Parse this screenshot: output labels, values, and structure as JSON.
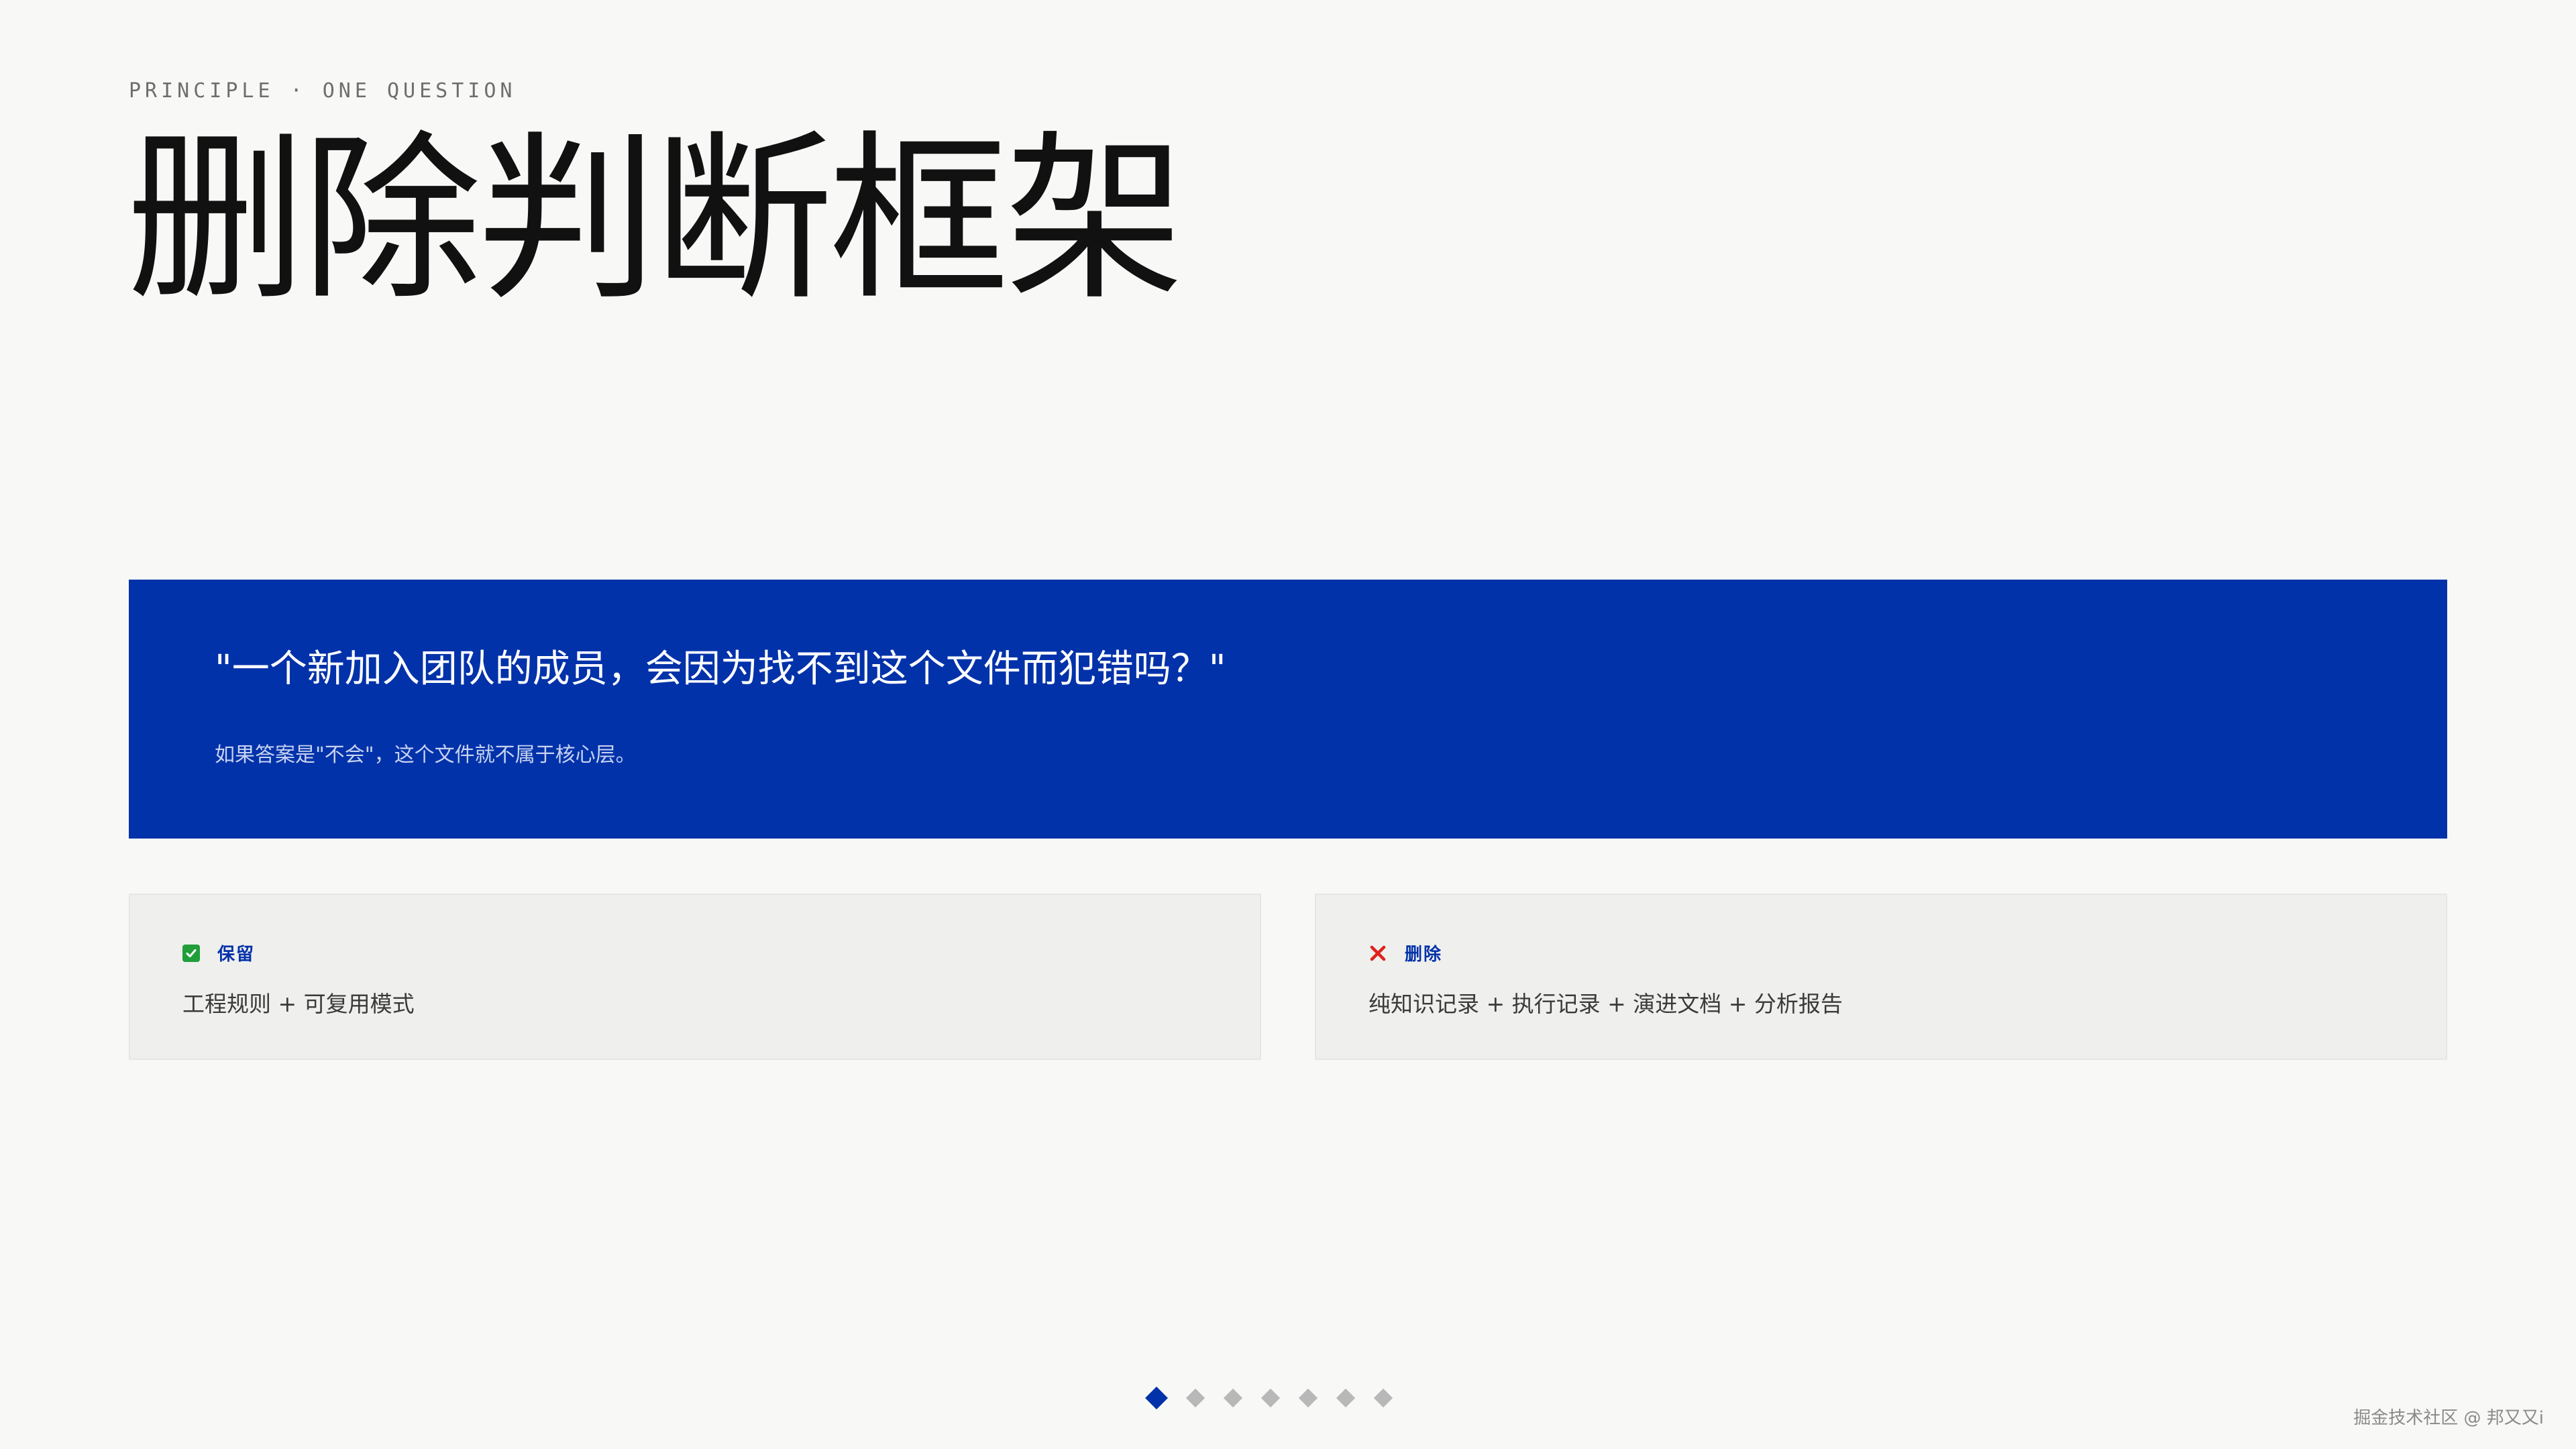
{
  "header": {
    "eyebrow": "PRINCIPLE · ONE QUESTION",
    "title": "删除判断框架"
  },
  "question": {
    "text": "\"一个新加入团队的成员，会因为找不到这个文件而犯错吗？\"",
    "note": "如果答案是\"不会\"，这个文件就不属于核心层。"
  },
  "cards": {
    "keep": {
      "icon": "check-icon",
      "label": "保留",
      "body": "工程规则 + 可复用模式"
    },
    "delete": {
      "icon": "cross-icon",
      "label": "删除",
      "body": "纯知识记录 + 执行记录 + 演进文档 + 分析报告"
    }
  },
  "pager": {
    "total": 7,
    "active_index": 0
  },
  "watermark": "掘金技术社区 @ 邦又又i",
  "colors": {
    "accent": "#0232aa",
    "background": "#f8f8f7",
    "card": "#efefee",
    "check": "#1f9e3a",
    "cross": "#e0201b"
  }
}
